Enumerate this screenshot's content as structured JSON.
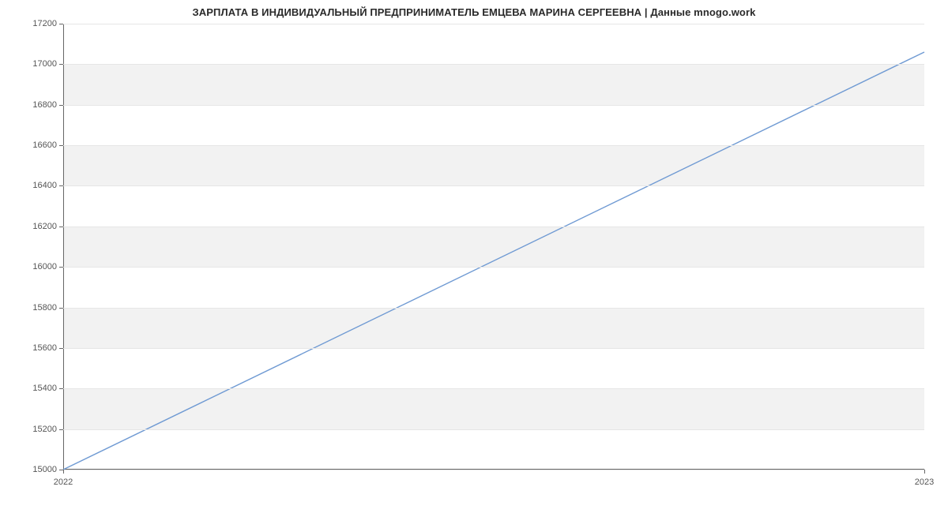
{
  "chart_data": {
    "type": "line",
    "title": "ЗАРПЛАТА В ИНДИВИДУАЛЬНЫЙ ПРЕДПРИНИМАТЕЛЬ ЕМЦЕВА МАРИНА СЕРГЕЕВНА | Данные mnogo.work",
    "x": [
      2022,
      2023
    ],
    "values": [
      15000,
      17060
    ],
    "x_tick_labels": [
      "2022",
      "2023"
    ],
    "y_ticks": [
      15000,
      15200,
      15400,
      15600,
      15800,
      16000,
      16200,
      16400,
      16600,
      16800,
      17000,
      17200
    ],
    "ylim": [
      15000,
      17200
    ],
    "xlim": [
      2022,
      2023
    ],
    "line_color": "#6f9ad3",
    "band_color": "#f2f2f2",
    "xlabel": "",
    "ylabel": ""
  }
}
